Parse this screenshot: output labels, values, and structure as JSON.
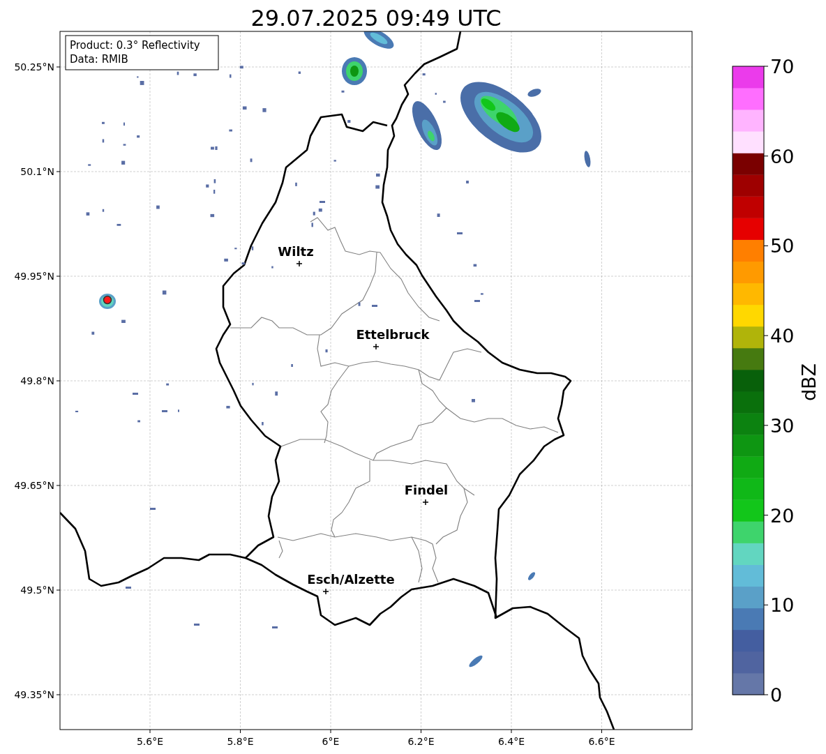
{
  "title": "29.07.2025 09:49 UTC",
  "info_box": {
    "lines": [
      "Product: 0.3° Reflectivity",
      "Data: RMIB"
    ]
  },
  "map": {
    "y_ticks": [
      "50.25°N",
      "50.1°N",
      "49.95°N",
      "49.8°N",
      "49.65°N",
      "49.5°N",
      "49.35°N"
    ],
    "x_ticks": [
      "5.6°E",
      "5.8°E",
      "6°E",
      "6.2°E",
      "6.4°E",
      "6.6°E"
    ],
    "places": [
      {
        "name": "Wiltz"
      },
      {
        "name": "Ettelbruck"
      },
      {
        "name": "Findel"
      },
      {
        "name": "Esch/Alzette"
      }
    ]
  },
  "colorbar": {
    "label": "dBZ",
    "ticks": [
      "70",
      "60",
      "50",
      "40",
      "30",
      "20",
      "10",
      "0"
    ],
    "bands": [
      {
        "color": "#6577a8"
      },
      {
        "color": "#5064a0"
      },
      {
        "color": "#445ea0"
      },
      {
        "color": "#4a7ab4"
      },
      {
        "color": "#5aa0c8"
      },
      {
        "color": "#62bcd8"
      },
      {
        "color": "#62d6c0"
      },
      {
        "color": "#3ed46c"
      },
      {
        "color": "#12c61a"
      },
      {
        "color": "#10b818"
      },
      {
        "color": "#10aa14"
      },
      {
        "color": "#0e9612"
      },
      {
        "color": "#0c8210"
      },
      {
        "color": "#0a700c"
      },
      {
        "color": "#08600a"
      },
      {
        "color": "#467a10"
      },
      {
        "color": "#b0b40a"
      },
      {
        "color": "#ffd800"
      },
      {
        "color": "#ffb800"
      },
      {
        "color": "#ff9a00"
      },
      {
        "color": "#ff7f00"
      },
      {
        "color": "#e60000"
      },
      {
        "color": "#c00000"
      },
      {
        "color": "#9e0000"
      },
      {
        "color": "#7a0000"
      },
      {
        "color": "#ffe0ff"
      },
      {
        "color": "#ffb4ff"
      },
      {
        "color": "#ff6eff"
      },
      {
        "color": "#eb3beb"
      }
    ]
  }
}
